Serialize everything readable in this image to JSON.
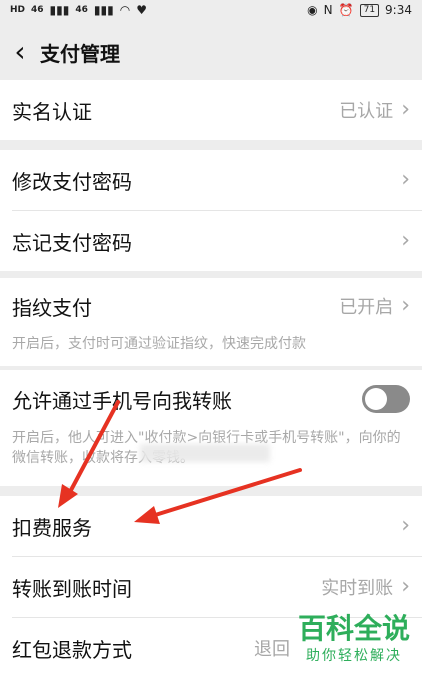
{
  "status_bar": {
    "left_text": "HD",
    "net1": "46",
    "net2": "46",
    "time": "9:34",
    "battery": "71"
  },
  "header": {
    "title": "支付管理"
  },
  "sections": [
    {
      "items": [
        {
          "label": "实名认证",
          "value": "已认证"
        }
      ]
    },
    {
      "items": [
        {
          "label": "修改支付密码",
          "value": ""
        },
        {
          "label": "忘记支付密码",
          "value": ""
        }
      ]
    },
    {
      "items": [
        {
          "label": "指纹支付",
          "value": "已开启",
          "hint": "开启后，支付时可通过验证指纹，快速完成付款"
        }
      ]
    },
    {
      "items": [
        {
          "label": "允许通过手机号向我转账",
          "toggle_on": false,
          "hint": "开启后，他人可进入\"收付款>向银行卡或手机号转账\"，向你的微信转账，收款将存入零钱。"
        }
      ]
    },
    {
      "items": [
        {
          "label": "扣费服务",
          "value": ""
        },
        {
          "label": "转账到账时间",
          "value": "实时到账"
        },
        {
          "label": "红包退款方式",
          "value": "退回"
        }
      ]
    }
  ],
  "watermark": {
    "main": "百科全说",
    "sub": "助你轻松解决"
  },
  "colors": {
    "annotation_arrow": "#e63222",
    "watermark": "#2eae5b"
  }
}
